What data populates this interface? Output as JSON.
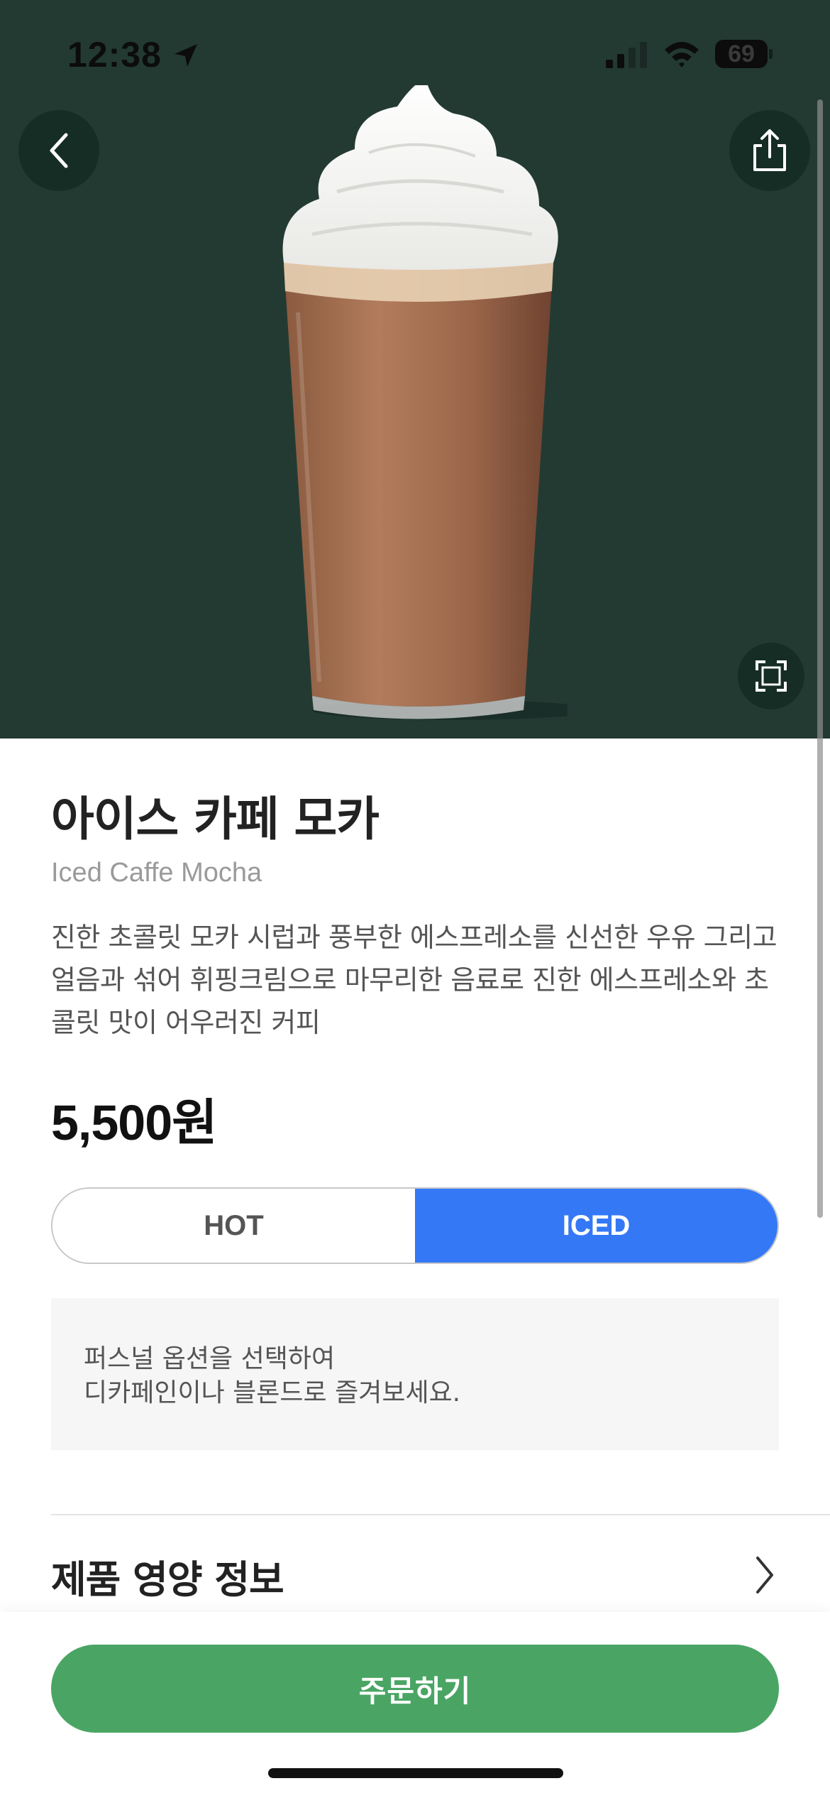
{
  "status_bar": {
    "time": "12:38",
    "battery": "69",
    "icons": [
      "location-arrow-icon",
      "cellular-signal-icon",
      "wifi-icon",
      "battery-icon"
    ]
  },
  "hero": {
    "background_color": "#233a33",
    "image": "iced-caffe-mocha-drink-image",
    "icons": [
      "chevron-left-icon",
      "share-icon",
      "expand-icon"
    ]
  },
  "product": {
    "name_ko": "아이스 카페 모카",
    "name_en": "Iced Caffe Mocha",
    "description": "진한 초콜릿 모카 시럽과 풍부한 에스프레소를 신선한 우유 그리고 얼음과 섞어 휘핑크림으로 마무리한 음료로 진한 에스프레소와 초콜릿 맛이 어우러진 커피",
    "price": "5,500원"
  },
  "temperature": {
    "options": [
      "HOT",
      "ICED"
    ],
    "selected": "ICED",
    "accent_color": "#3478f6"
  },
  "notice": {
    "line1": "퍼스널 옵션을 선택하여",
    "line2": "디카페인이나 블론드로 즐겨보세요."
  },
  "nutrition": {
    "label": "제품 영양 정보",
    "icon": "chevron-right-icon"
  },
  "order": {
    "label": "주문하기",
    "color": "#4aa564"
  }
}
